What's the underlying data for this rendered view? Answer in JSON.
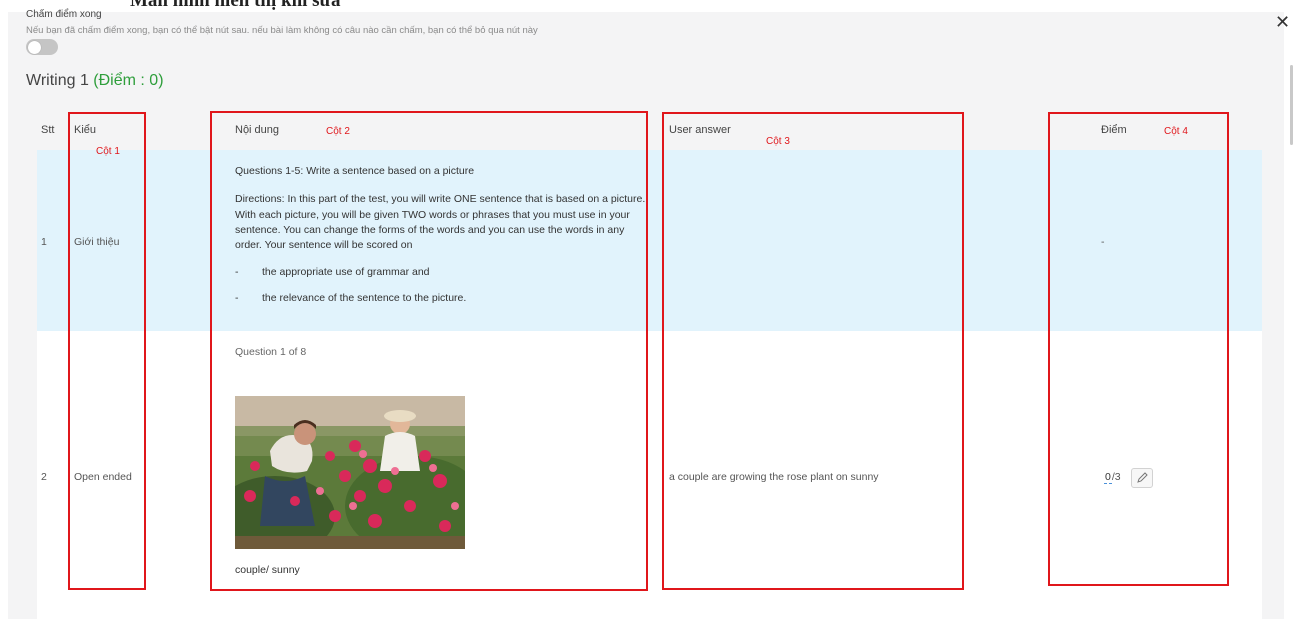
{
  "page_title": "Màn hình hiển thị khi sửa",
  "close_icon": "close-icon",
  "done_section": {
    "label": "Chấm điểm xong",
    "hint": "Nếu bạn đã chấm điểm xong, bạn có thể bật nút sau. nếu bài làm không có câu nào cần chấm, bạn có thể bỏ qua nút này",
    "toggle_on": false
  },
  "section": {
    "title": "Writing 1",
    "score_text": "(Điểm : 0)"
  },
  "table": {
    "headers": {
      "stt": "Stt",
      "kieu": "Kiểu",
      "noi_dung": "Nội dung",
      "user_answer": "User answer",
      "diem": "Điểm"
    },
    "column_tags": {
      "col1": "Cột 1",
      "col2": "Cột 2",
      "col3": "Cột 3",
      "col4": "Cột 4"
    },
    "rows": [
      {
        "stt": "1",
        "kieu": "Giới thiệu",
        "content_title": "Questions 1-5: Write a sentence based on a picture",
        "directions": [
          "Directions: In this part of the test, you will write ONE sentence that is based on a picture.",
          "With each picture, you will be given TWO words or phrases that you must use in your",
          "sentence. You can change the forms of the words and you can use the words in any",
          "order. Your sentence will be scored on"
        ],
        "bullets": [
          {
            "dash": "-",
            "text": "the appropriate use of grammar and"
          },
          {
            "dash": "-",
            "text": "the relevance of the sentence to the picture."
          }
        ],
        "user_answer": "",
        "score": "-"
      },
      {
        "stt": "2",
        "kieu": "Open ended",
        "question_counter": "Question 1 of 8",
        "picture": "couple-gardening-roses-photo",
        "keywords": "couple/ sunny",
        "user_answer": "a couple are growing the rose plant on sunny",
        "score_value": "0",
        "score_max": "/3",
        "edit_icon": "pencil-icon"
      }
    ]
  },
  "colors": {
    "annotation_red": "#e0161b",
    "score_green": "#2e9e3b",
    "row_highlight": "#e1f3fc"
  }
}
